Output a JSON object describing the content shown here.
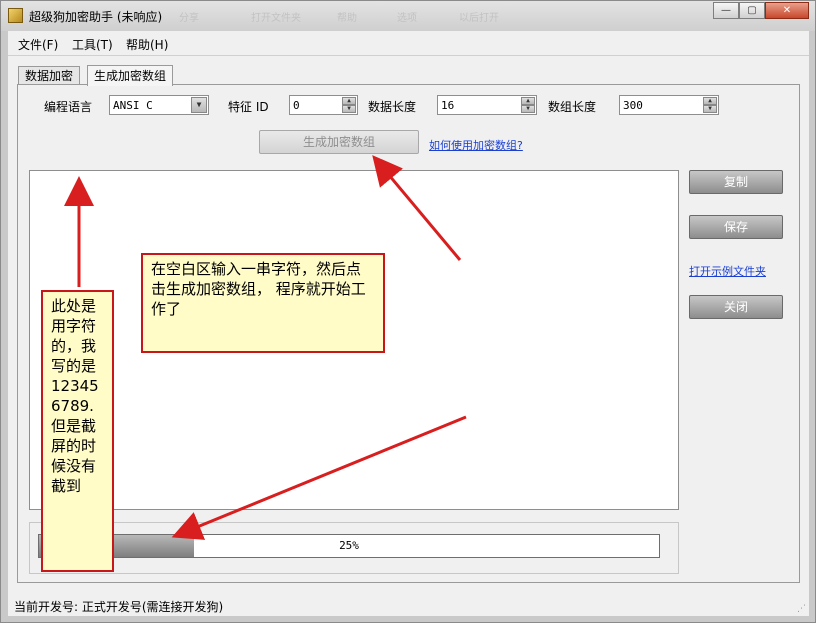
{
  "window": {
    "title": "超级狗加密助手 (未响应)",
    "ghost_toolbar": [
      "分享",
      "打开文件夹",
      "帮助",
      "选项",
      "以后打开"
    ],
    "controls": {
      "minimize": "—",
      "maximize": "▢",
      "close": "✕"
    }
  },
  "menu": {
    "file": "文件(F)",
    "tools": "工具(T)",
    "help": "帮助(H)"
  },
  "tabs": [
    {
      "label": "数据加密",
      "active": false
    },
    {
      "label": "生成加密数组",
      "active": true
    }
  ],
  "form": {
    "language_label": "编程语言",
    "language_value": "ANSI C",
    "feature_label": "特征 ID",
    "feature_value": "0",
    "data_length_label": "数据长度",
    "data_length_value": "16",
    "array_length_label": "数组长度",
    "array_length_value": "300"
  },
  "generate_button": "生成加密数组",
  "help_link": "如何使用加密数组?",
  "side": {
    "copy": "复制",
    "save": "保存",
    "open_folder_link": "打开示例文件夹",
    "close": "关闭"
  },
  "progress": {
    "value": 0.25,
    "text": "25%"
  },
  "status": "当前开发号: 正式开发号(需连接开发狗)",
  "annotations": {
    "note1": "在空白区输入一串字符，然后点击生成加密数组， 程序就开始工作了",
    "note2": "此处是用字符的，我写的是123456789.但是截屏的时候没有截到"
  },
  "colors": {
    "annotation_border": "#c8171b",
    "annotation_bg": "#fffcc8",
    "arrow": "#d81e1e",
    "link": "#1a3fd1"
  }
}
